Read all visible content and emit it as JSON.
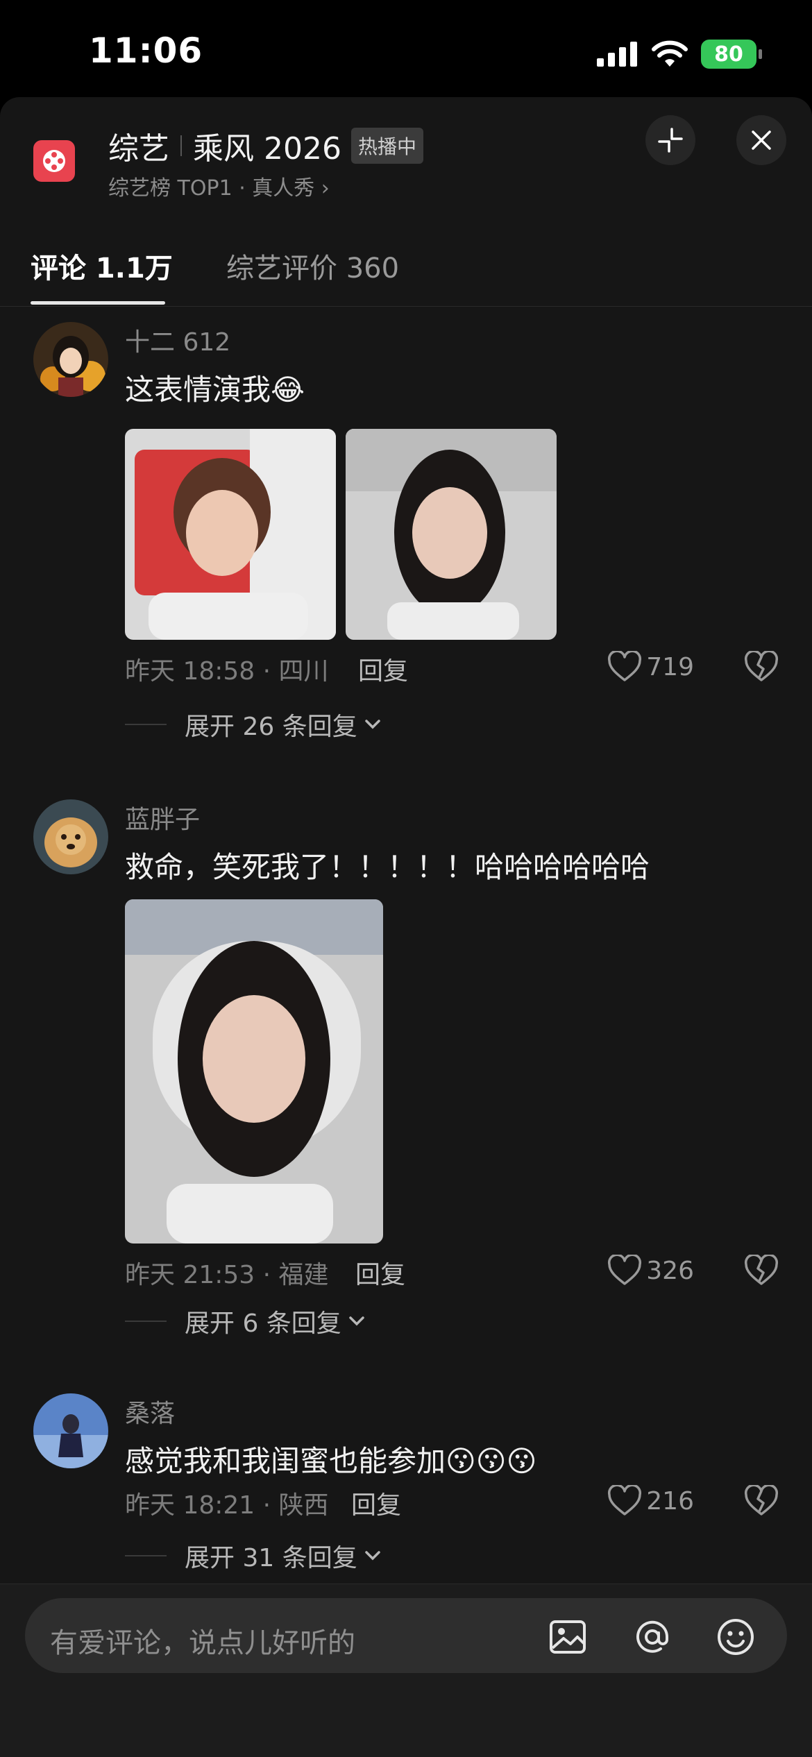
{
  "status_bar": {
    "time": "11:06",
    "battery": "80"
  },
  "header": {
    "title": "综艺",
    "show_name": "乘风 2026",
    "badge": "热播中",
    "subtitle": "综艺榜 TOP1 · 真人秀 ›"
  },
  "tabs": [
    {
      "label": "评论 1.1万",
      "active": true
    },
    {
      "label": "综艺评价 360",
      "active": false
    }
  ],
  "comments": [
    {
      "username": "十二 612",
      "text": "这表情演我😂",
      "time_location": "昨天 18:58 · 四川",
      "reply": "回复",
      "likes": "719",
      "expand": "展开 26 条回复"
    },
    {
      "username": "蓝胖子",
      "text": "救命，笑死我了！！！！！哈哈哈哈哈哈",
      "time_location": "昨天 21:53 · 福建",
      "reply": "回复",
      "likes": "326",
      "expand": "展开 6 条回复"
    },
    {
      "username": "桑落",
      "text": "感觉我和我闺蜜也能参加😗😗😗",
      "time_location": "昨天 18:21 · 陕西",
      "reply": "回复",
      "likes": "216",
      "expand": "展开 31 条回复"
    }
  ],
  "input": {
    "placeholder": "有爱评论，说点儿好听的"
  }
}
